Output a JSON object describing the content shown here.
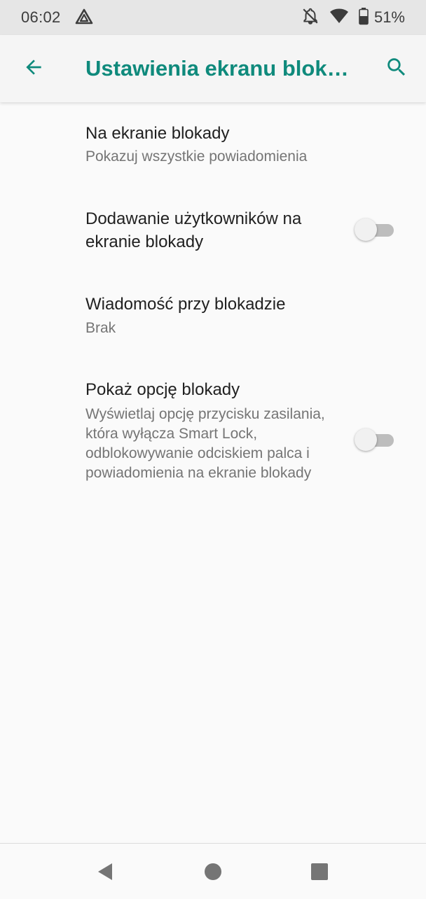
{
  "status_bar": {
    "time": "06:02",
    "battery_percent": "51%",
    "icons": [
      "app-notification-icon",
      "notifications-off-icon",
      "wifi-icon",
      "battery-icon"
    ]
  },
  "app_bar": {
    "title": "Ustawienia ekranu blokady",
    "back_icon": "arrow-back-icon",
    "search_icon": "search-icon",
    "accent_color": "#0f8a7c"
  },
  "preferences": [
    {
      "title": "Na ekranie blokady",
      "summary": "Pokazuj wszystkie powiadomienia"
    },
    {
      "title": "Dodawanie użytkowników na ekranie blokady",
      "toggle": false
    },
    {
      "title": "Wiadomość przy blokadzie",
      "summary": "Brak"
    },
    {
      "title": "Pokaż opcję blokady",
      "summary": "Wyświetlaj opcję przycisku zasilania, która wyłącza Smart Lock, odblokowywanie odciskiem palca i powiadomienia na ekranie blokady",
      "toggle": false
    }
  ],
  "nav_bar": {
    "icons": [
      "back-triangle-icon",
      "home-circle-icon",
      "recents-square-icon"
    ]
  }
}
